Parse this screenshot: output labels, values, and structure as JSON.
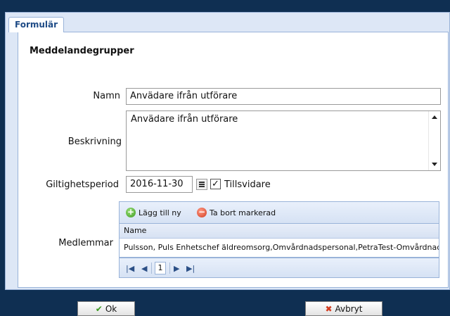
{
  "tab": {
    "label": "Formulär"
  },
  "section": {
    "title": "Meddelandegrupper"
  },
  "fields": {
    "namn": {
      "label": "Namn",
      "value": "Anvädare ifrån utförare"
    },
    "beskrivning": {
      "label": "Beskrivning",
      "value": "Anvädare ifrån utförare"
    },
    "giltighet": {
      "label": "Giltighetsperiod",
      "value": "2016-11-30",
      "checkbox_label": "Tillsvidare",
      "checkbox_mark": "✓"
    },
    "medlemmar": {
      "label": "Medlemmar"
    }
  },
  "grid": {
    "toolbar": {
      "add": "Lägg till ny",
      "remove": "Ta bort markerad"
    },
    "columns": [
      "Name"
    ],
    "rows": [
      "Pulsson, Puls Enhetschef äldreomsorg,Omvårdnadspersonal,PetraTest-Omvårdnad"
    ],
    "pager": {
      "page": "1"
    }
  },
  "buttons": {
    "ok": "Ok",
    "cancel": "Avbryt"
  }
}
